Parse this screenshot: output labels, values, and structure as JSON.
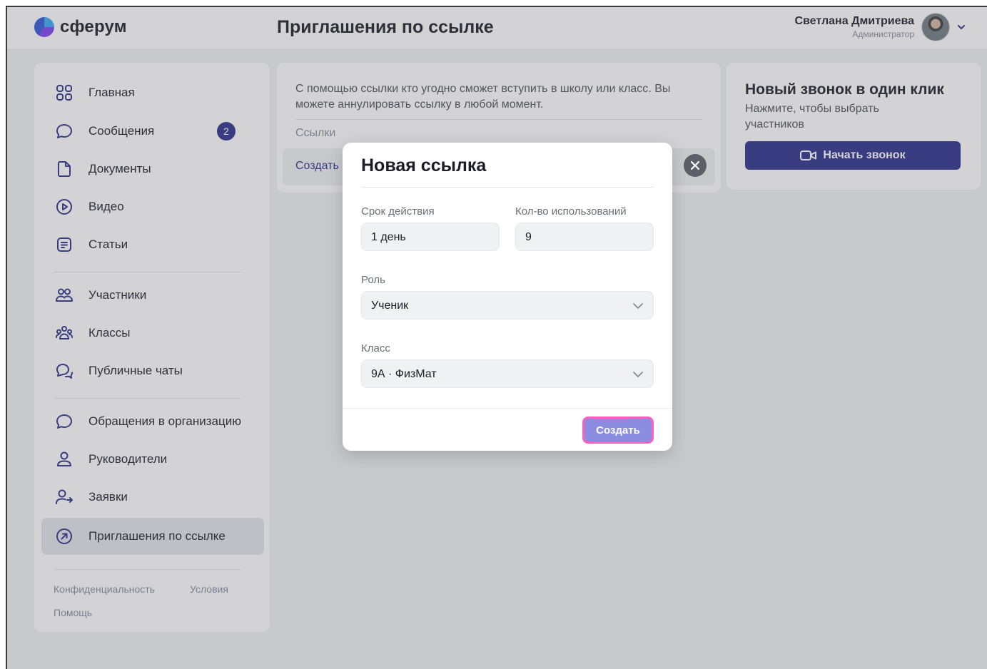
{
  "header": {
    "logo_text": "сферум",
    "page_title": "Приглашения по ссылке",
    "user_name": "Светлана Дмитриева",
    "user_role": "Администратор"
  },
  "sidebar": {
    "items": [
      {
        "label": "Главная",
        "icon": "grid-icon"
      },
      {
        "label": "Сообщения",
        "icon": "message-bubble-icon",
        "badge": "2"
      },
      {
        "label": "Документы",
        "icon": "document-icon"
      },
      {
        "label": "Видео",
        "icon": "play-circle-icon"
      },
      {
        "label": "Статьи",
        "icon": "article-icon"
      },
      {
        "label": "Участники",
        "icon": "users-icon"
      },
      {
        "label": "Классы",
        "icon": "group-icon"
      },
      {
        "label": "Публичные чаты",
        "icon": "public-chat-icon"
      },
      {
        "label": "Обращения в организацию",
        "icon": "message-bubble-icon"
      },
      {
        "label": "Руководители",
        "icon": "user-icon"
      },
      {
        "label": "Заявки",
        "icon": "user-arrow-icon"
      },
      {
        "label": "Приглашения по ссылке",
        "icon": "arrow-circle-icon",
        "active": true
      }
    ],
    "footer": {
      "privacy": "Конфиденциальность",
      "terms": "Условия",
      "help": "Помощь"
    }
  },
  "main": {
    "description": "С помощью ссылки кто угодно сможет вступить в школу или класс. Вы можете аннулировать ссылку в любой момент.",
    "links_label": "Ссылки",
    "create_link": "Создать"
  },
  "call_card": {
    "title": "Новый звонок в один клик",
    "subtitle": "Нажмите, чтобы выбрать участников",
    "button": "Начать звонок"
  },
  "modal": {
    "title": "Новая ссылка",
    "duration_label": "Срок действия",
    "duration_value": "1 день",
    "uses_label": "Кол-во использований",
    "uses_value": "9",
    "role_label": "Роль",
    "role_value": "Ученик",
    "class_label": "Класс",
    "class_value": "9А · ФизМат",
    "create_button": "Создать"
  },
  "colors": {
    "accent": "#2b2f8c",
    "highlight": "#ff5fbf",
    "button_disabled": "#8a8ce0"
  }
}
